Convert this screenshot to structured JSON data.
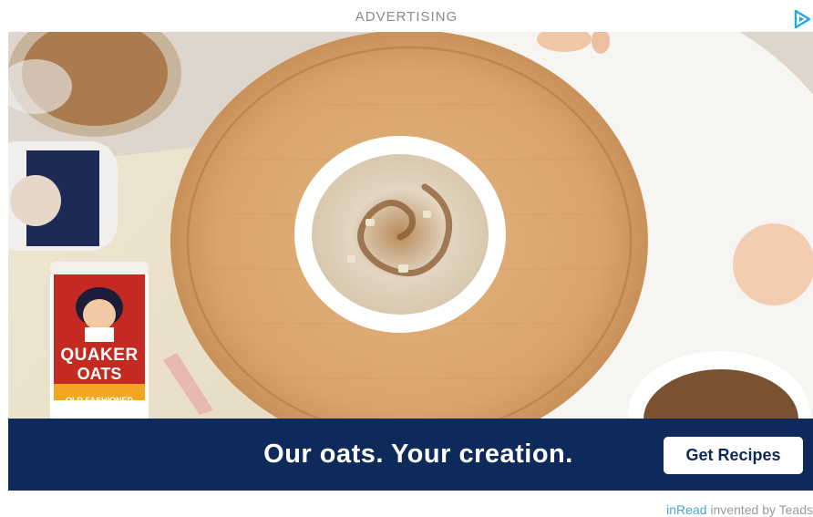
{
  "ad": {
    "label": "ADVERTISING",
    "choices_icon": "adchoices-play-icon",
    "accent_color": "#1fa8e0"
  },
  "creative": {
    "tagline": "Our oats. Your creation.",
    "cta_label": "Get Recipes",
    "banner_color": "#0d2a5a",
    "product": {
      "brand_line1": "QUAKER",
      "brand_line2": "OATS",
      "variant": "OLD FASHIONED"
    },
    "jar_label": "QUAKER OATS"
  },
  "footer": {
    "link_text": "inRead",
    "suffix": " invented by Teads",
    "link_color": "#4da3dd"
  }
}
